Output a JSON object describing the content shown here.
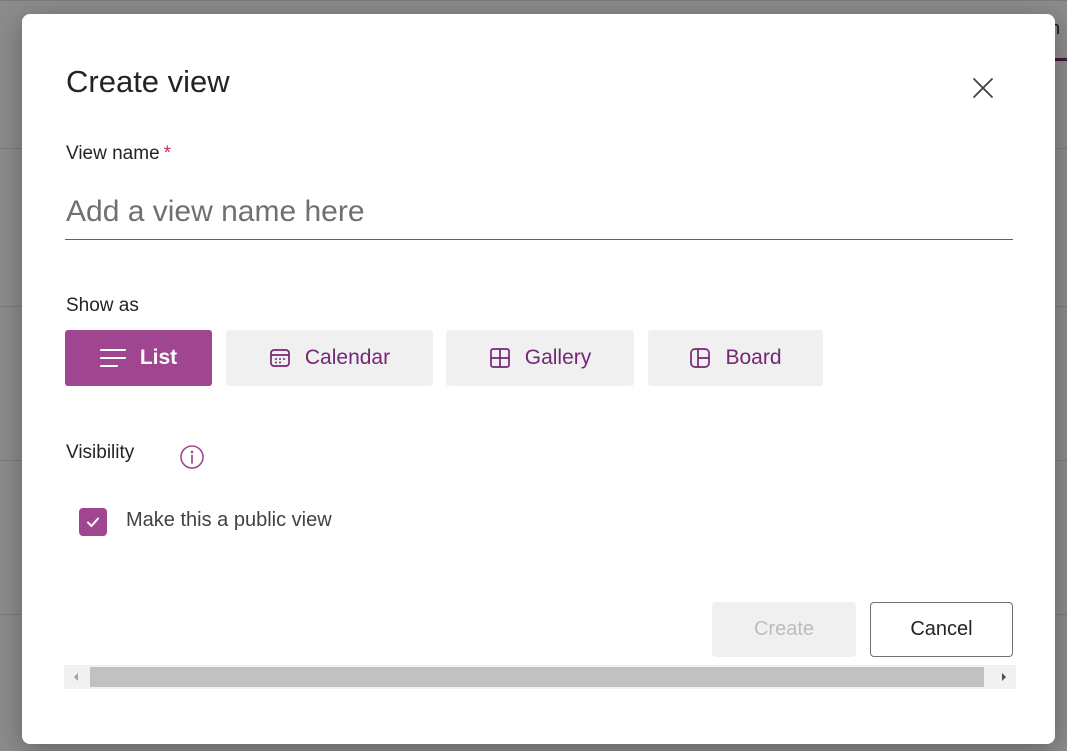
{
  "background": {
    "tab_text": "n"
  },
  "dialog": {
    "title": "Create view",
    "view_name": {
      "label": "View name",
      "required_mark": "*",
      "placeholder": "Add a view name here",
      "value": ""
    },
    "show_as": {
      "label": "Show as",
      "options": [
        {
          "label": "List",
          "icon": "list-icon",
          "selected": true
        },
        {
          "label": "Calendar",
          "icon": "calendar-icon",
          "selected": false
        },
        {
          "label": "Gallery",
          "icon": "gallery-icon",
          "selected": false
        },
        {
          "label": "Board",
          "icon": "board-icon",
          "selected": false
        }
      ]
    },
    "visibility": {
      "label": "Visibility",
      "public_checkbox_label": "Make this a public view",
      "public_checked": true
    },
    "buttons": {
      "create": "Create",
      "cancel": "Cancel"
    }
  },
  "colors": {
    "accent": "#a0458f",
    "accent_text": "#742774",
    "required": "#c4314b",
    "disabled_text": "#bdbdbd"
  }
}
